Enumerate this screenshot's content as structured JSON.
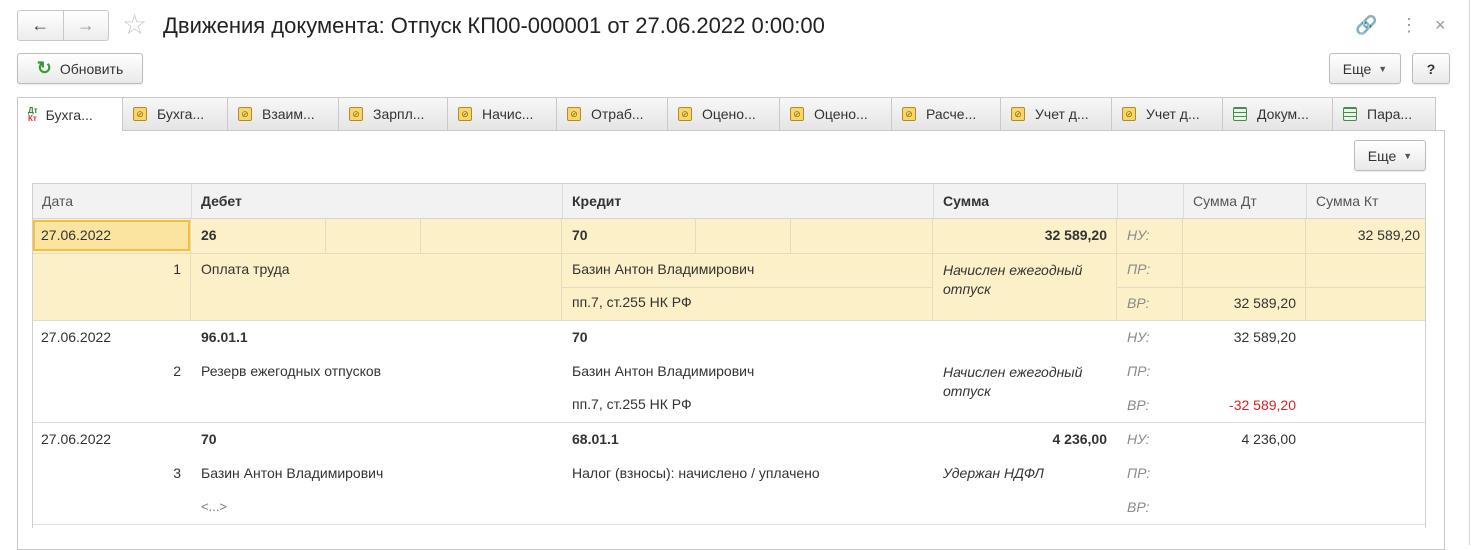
{
  "header": {
    "title": "Движения документа: Отпуск КП00-000001 от 27.06.2022 0:00:00",
    "back_icon": "←",
    "forward_icon": "→",
    "star_icon": "☆",
    "link_icon": "🔗",
    "menu_icon": "⋮",
    "close_icon": "×"
  },
  "toolbar": {
    "refresh_label": "Обновить",
    "more_label": "Еще",
    "help_label": "?",
    "refresh_icon": "↻"
  },
  "tabs": [
    {
      "label": "Бухга..."
    },
    {
      "label": "Бухга..."
    },
    {
      "label": "Взаим..."
    },
    {
      "label": "Зарпл..."
    },
    {
      "label": "Начис..."
    },
    {
      "label": "Отраб..."
    },
    {
      "label": "Оцено..."
    },
    {
      "label": "Оцено..."
    },
    {
      "label": "Расче..."
    },
    {
      "label": "Учет д..."
    },
    {
      "label": "Учет д..."
    },
    {
      "label": "Докум..."
    },
    {
      "label": "Пара..."
    }
  ],
  "panel": {
    "more_label": "Еще"
  },
  "table": {
    "columns": {
      "date": "Дата",
      "debit": "Дебет",
      "credit": "Кредит",
      "sum": "Сумма",
      "blank": "",
      "sum_dt": "Сумма Дт",
      "sum_kt": "Сумма Кт"
    },
    "rows": [
      {
        "date": "27.06.2022",
        "num": "1",
        "debit_account": "26",
        "debit_sub": "Оплата труда",
        "credit_account": "70",
        "credit_sub1": "Базин Антон Владимирович",
        "credit_sub2": "пп.7, ст.255 НК РФ",
        "sum": "32 589,20",
        "content": "Начислен ежегодный отпуск",
        "nu": "НУ:",
        "pr": "ПР:",
        "vr": "ВР:",
        "nu_dt": "",
        "pr_dt": "",
        "vr_dt": "32 589,20",
        "nu_kt": "32 589,20"
      },
      {
        "date": "27.06.2022",
        "num": "2",
        "debit_account": "96.01.1",
        "debit_sub": "Резерв ежегодных отпусков",
        "credit_account": "70",
        "credit_sub1": "Базин Антон Владимирович",
        "credit_sub2": "пп.7, ст.255 НК РФ",
        "sum": "",
        "content": "Начислен ежегодный отпуск",
        "nu": "НУ:",
        "pr": "ПР:",
        "vr": "ВР:",
        "nu_dt": "32 589,20",
        "pr_dt": "",
        "vr_dt": "-32 589,20",
        "nu_kt": ""
      },
      {
        "date": "27.06.2022",
        "num": "3",
        "debit_account": "70",
        "debit_sub": "Базин Антон Владимирович",
        "debit_sub2": "<...>",
        "credit_account": "68.01.1",
        "credit_sub1": "Налог (взносы): начислено / уплачено",
        "sum": "4 236,00",
        "content": "Удержан НДФЛ",
        "nu": "НУ:",
        "pr": "ПР:",
        "vr": "ВР:",
        "nu_dt": "4 236,00",
        "pr_dt": "",
        "vr_dt": "",
        "nu_kt": ""
      }
    ]
  },
  "colors": {
    "selected_row": "#fbf0c8",
    "negative": "#e02020",
    "refresh_icon": "#3a9a3a"
  }
}
